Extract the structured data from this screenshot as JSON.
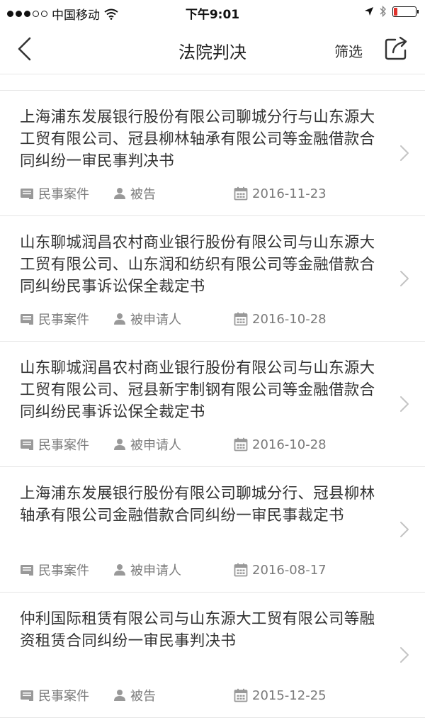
{
  "status_bar": {
    "carrier": "中国移动",
    "time": "下午9:01",
    "battery_color": "#e0322c",
    "battery_level": 0.15
  },
  "nav": {
    "title": "法院判决",
    "filter_label": "筛选",
    "back_icon": "chevron-left-icon",
    "share_icon": "share-icon"
  },
  "list": [
    {
      "title": "上海浦东发展银行股份有限公司聊城分行与山东源大工贸有限公司、冠县柳林轴承有限公司等金融借款合同纠纷一审民事判决书",
      "type": "民事案件",
      "role": "被告",
      "date": "2016-11-23"
    },
    {
      "title": "山东聊城润昌农村商业银行股份有限公司与山东源大工贸有限公司、山东润和纺织有限公司等金融借款合同纠纷民事诉讼保全裁定书",
      "type": "民事案件",
      "role": "被申请人",
      "date": "2016-10-28"
    },
    {
      "title": "山东聊城润昌农村商业银行股份有限公司与山东源大工贸有限公司、冠县新宇制钢有限公司等金融借款合同纠纷民事诉讼保全裁定书",
      "type": "民事案件",
      "role": "被申请人",
      "date": "2016-10-28"
    },
    {
      "title": "上海浦东发展银行股份有限公司聊城分行、冠县柳林轴承有限公司金融借款合同纠纷一审民事裁定书",
      "type": "民事案件",
      "role": "被申请人",
      "date": "2016-08-17"
    },
    {
      "title": "仲利国际租赁有限公司与山东源大工贸有限公司等融资租赁合同纠纷一审民事判决书",
      "type": "民事案件",
      "role": "被告",
      "date": "2015-12-25"
    }
  ]
}
